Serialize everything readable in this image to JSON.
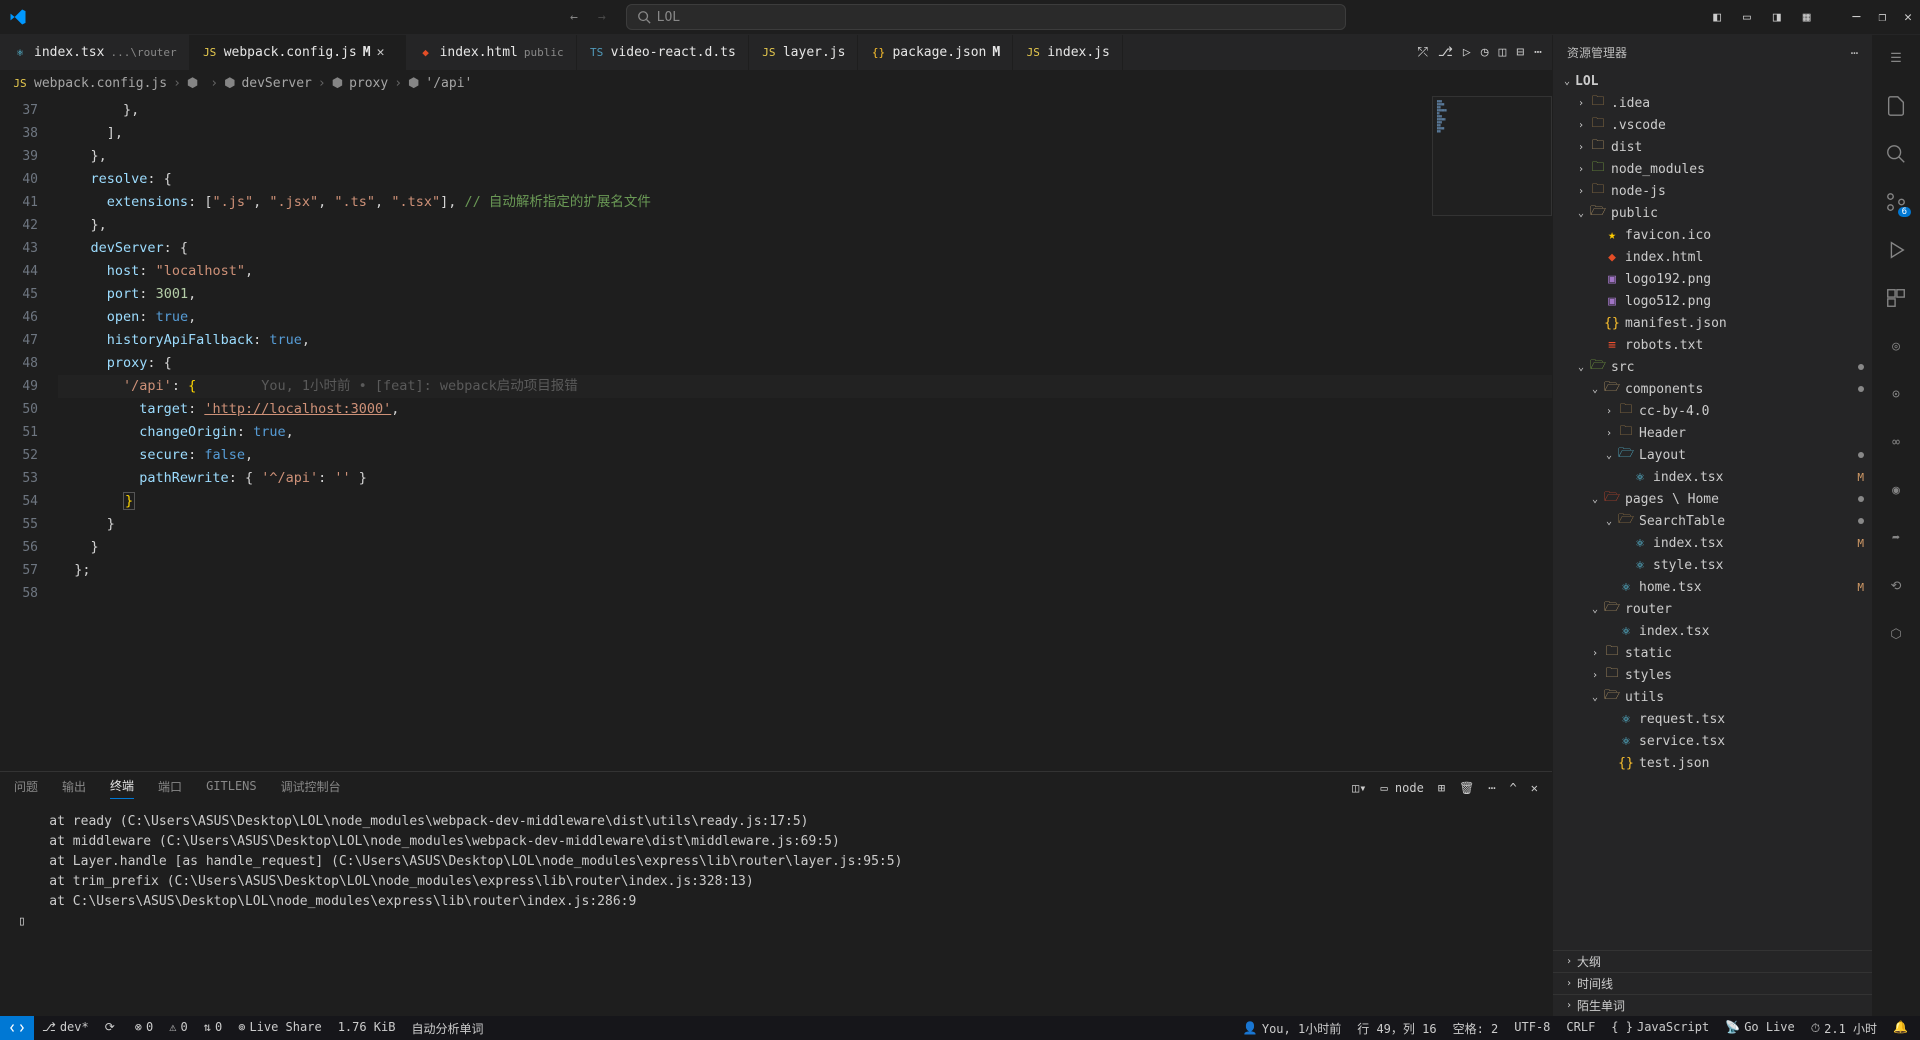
{
  "title": {
    "search": "LOL"
  },
  "tabs": [
    {
      "icon": "react",
      "name": "index.tsx",
      "path": "...\\router",
      "active": false
    },
    {
      "icon": "js",
      "name": "webpack.config.js",
      "mod": "M",
      "active": true,
      "close": true
    },
    {
      "icon": "html",
      "name": "index.html",
      "path": "public",
      "active": false
    },
    {
      "icon": "ts",
      "name": "video-react.d.ts",
      "active": false
    },
    {
      "icon": "js",
      "name": "layer.js",
      "active": false
    },
    {
      "icon": "json",
      "name": "package.json",
      "mod": "M",
      "active": false
    },
    {
      "icon": "js",
      "name": "index.js",
      "active": false
    }
  ],
  "breadcrumb": [
    "webpack.config.js",
    "<unknown>",
    "devServer",
    "proxy",
    "'/api'"
  ],
  "code": {
    "start": 37,
    "lines": [
      {
        "t": "        },"
      },
      {
        "t": "      ],"
      },
      {
        "t": "    },"
      },
      {
        "t": "    resolve: {",
        "seg": [
          {
            "c": "prop",
            "t": "resolve"
          },
          {
            "c": "punct",
            "t": ": {"
          }
        ]
      },
      {
        "t": "      extensions: [\".js\", \".jsx\", \".ts\", \".tsx\"], // 自动解析指定的扩展名文件",
        "seg": [
          {
            "c": "prop",
            "t": "extensions"
          },
          {
            "c": "punct",
            "t": ": ["
          },
          {
            "c": "str",
            "t": "\".js\""
          },
          {
            "c": "punct",
            "t": ", "
          },
          {
            "c": "str",
            "t": "\".jsx\""
          },
          {
            "c": "punct",
            "t": ", "
          },
          {
            "c": "str",
            "t": "\".ts\""
          },
          {
            "c": "punct",
            "t": ", "
          },
          {
            "c": "str",
            "t": "\".tsx\""
          },
          {
            "c": "punct",
            "t": "], "
          },
          {
            "c": "cmt",
            "t": "// 自动解析指定的扩展名文件"
          }
        ]
      },
      {
        "t": "    },"
      },
      {
        "t": "    devServer: {",
        "seg": [
          {
            "c": "prop",
            "t": "devServer"
          },
          {
            "c": "punct",
            "t": ": {"
          }
        ]
      },
      {
        "t": "      host: \"localhost\",",
        "seg": [
          {
            "c": "prop",
            "t": "host"
          },
          {
            "c": "punct",
            "t": ": "
          },
          {
            "c": "str",
            "t": "\"localhost\""
          },
          {
            "c": "punct",
            "t": ","
          }
        ]
      },
      {
        "t": "      port: 3001,",
        "seg": [
          {
            "c": "prop",
            "t": "port"
          },
          {
            "c": "punct",
            "t": ": "
          },
          {
            "c": "num",
            "t": "3001"
          },
          {
            "c": "punct",
            "t": ","
          }
        ]
      },
      {
        "t": "      open: true,",
        "seg": [
          {
            "c": "prop",
            "t": "open"
          },
          {
            "c": "punct",
            "t": ": "
          },
          {
            "c": "bool",
            "t": "true"
          },
          {
            "c": "punct",
            "t": ","
          }
        ]
      },
      {
        "t": "      historyApiFallback: true,",
        "seg": [
          {
            "c": "prop",
            "t": "historyApiFallback"
          },
          {
            "c": "punct",
            "t": ": "
          },
          {
            "c": "bool",
            "t": "true"
          },
          {
            "c": "punct",
            "t": ","
          }
        ]
      },
      {
        "t": "      proxy: {",
        "seg": [
          {
            "c": "prop",
            "t": "proxy"
          },
          {
            "c": "punct",
            "t": ": {"
          }
        ]
      },
      {
        "t": "        '/api': {",
        "cursor": true,
        "seg": [
          {
            "c": "str",
            "t": "'/api'"
          },
          {
            "c": "punct",
            "t": ": "
          },
          {
            "c": "bracket",
            "t": "{"
          }
        ],
        "lens": "        You, 1小时前 • [feat]: webpack启动项目报错"
      },
      {
        "t": "          target: 'http://localhost:3000',",
        "seg": [
          {
            "c": "prop",
            "t": "target"
          },
          {
            "c": "punct",
            "t": ": "
          },
          {
            "c": "link",
            "t": "'http://localhost:3000'"
          },
          {
            "c": "punct",
            "t": ","
          }
        ]
      },
      {
        "t": "          changeOrigin: true,",
        "seg": [
          {
            "c": "prop",
            "t": "changeOrigin"
          },
          {
            "c": "punct",
            "t": ": "
          },
          {
            "c": "bool",
            "t": "true"
          },
          {
            "c": "punct",
            "t": ","
          }
        ]
      },
      {
        "t": "          secure: false,",
        "seg": [
          {
            "c": "prop",
            "t": "secure"
          },
          {
            "c": "punct",
            "t": ": "
          },
          {
            "c": "bool",
            "t": "false"
          },
          {
            "c": "punct",
            "t": ","
          }
        ]
      },
      {
        "t": "          pathRewrite: { '^/api': '' }",
        "seg": [
          {
            "c": "prop",
            "t": "pathRewrite"
          },
          {
            "c": "punct",
            "t": ": { "
          },
          {
            "c": "str",
            "t": "'^/api'"
          },
          {
            "c": "punct",
            "t": ": "
          },
          {
            "c": "str",
            "t": "''"
          },
          {
            "c": "punct",
            "t": " }"
          }
        ]
      },
      {
        "t": "        }",
        "seg": [
          {
            "c": "bracket",
            "t": "}"
          }
        ],
        "box": true
      },
      {
        "t": "      }"
      },
      {
        "t": "    }"
      },
      {
        "t": "  };"
      },
      {
        "t": ""
      }
    ]
  },
  "panel": {
    "tabs": [
      "问题",
      "输出",
      "终端",
      "端口",
      "GITLENS",
      "调试控制台"
    ],
    "active": "终端",
    "term_label": "node",
    "body": "    at ready (C:\\Users\\ASUS\\Desktop\\LOL\\node_modules\\webpack-dev-middleware\\dist\\utils\\ready.js:17:5)\n    at middleware (C:\\Users\\ASUS\\Desktop\\LOL\\node_modules\\webpack-dev-middleware\\dist\\middleware.js:69:5)\n    at Layer.handle [as handle_request] (C:\\Users\\ASUS\\Desktop\\LOL\\node_modules\\express\\lib\\router\\layer.js:95:5)\n    at trim_prefix (C:\\Users\\ASUS\\Desktop\\LOL\\node_modules\\express\\lib\\router\\index.js:328:13)\n    at C:\\Users\\ASUS\\Desktop\\LOL\\node_modules\\express\\lib\\router\\index.js:286:9\n▯"
  },
  "explorer": {
    "title": "资源管理器",
    "root": "LOL",
    "sections": [
      "大纲",
      "时间线",
      "陌生单词"
    ],
    "tree": [
      {
        "d": 1,
        "tw": ">",
        "ico": "folder",
        "name": ".idea"
      },
      {
        "d": 1,
        "tw": ">",
        "ico": "folder",
        "name": ".vscode"
      },
      {
        "d": 1,
        "tw": ">",
        "ico": "folder",
        "col": "ic-folder",
        "name": "dist"
      },
      {
        "d": 1,
        "tw": ">",
        "ico": "folder",
        "col": "ic-green",
        "name": "node_modules"
      },
      {
        "d": 1,
        "tw": ">",
        "ico": "folder",
        "name": "node-js"
      },
      {
        "d": 1,
        "tw": "v",
        "ico": "folder-o",
        "col": "ic-folder",
        "name": "public"
      },
      {
        "d": 2,
        "ico": "star",
        "col": "ic-fav",
        "name": "favicon.ico"
      },
      {
        "d": 2,
        "ico": "html",
        "col": "ic-html",
        "name": "index.html"
      },
      {
        "d": 2,
        "ico": "img",
        "col": "ic-img",
        "name": "logo192.png"
      },
      {
        "d": 2,
        "ico": "img",
        "col": "ic-img",
        "name": "logo512.png"
      },
      {
        "d": 2,
        "ico": "json",
        "col": "ic-json",
        "name": "manifest.json"
      },
      {
        "d": 2,
        "ico": "txt",
        "col": "ic-git",
        "name": "robots.txt"
      },
      {
        "d": 1,
        "tw": "v",
        "ico": "folder-o",
        "col": "ic-green",
        "name": "src",
        "dot": true
      },
      {
        "d": 2,
        "tw": "v",
        "ico": "folder-o",
        "col": "ic-folder",
        "name": "components",
        "dot": true
      },
      {
        "d": 3,
        "tw": ">",
        "ico": "folder",
        "name": "cc-by-4.0"
      },
      {
        "d": 3,
        "tw": ">",
        "ico": "folder",
        "name": "Header"
      },
      {
        "d": 3,
        "tw": "v",
        "ico": "folder-o",
        "col": "ic-react",
        "name": "Layout",
        "dot": true
      },
      {
        "d": 4,
        "ico": "react",
        "col": "ic-react",
        "name": "index.tsx",
        "badge": "M"
      },
      {
        "d": 2,
        "tw": "v",
        "ico": "folder-o",
        "col": "ic-git",
        "name": "pages \\ Home",
        "dot": true
      },
      {
        "d": 3,
        "tw": "v",
        "ico": "folder-o",
        "name": "SearchTable",
        "dot": true
      },
      {
        "d": 4,
        "ico": "react",
        "col": "ic-react",
        "name": "index.tsx",
        "badge": "M"
      },
      {
        "d": 4,
        "ico": "react",
        "col": "ic-react",
        "name": "style.tsx"
      },
      {
        "d": 3,
        "ico": "react",
        "col": "ic-react",
        "name": "home.tsx",
        "badge": "M"
      },
      {
        "d": 2,
        "tw": "v",
        "ico": "folder-o",
        "col": "ic-folder",
        "name": "router"
      },
      {
        "d": 3,
        "ico": "react",
        "col": "ic-react",
        "name": "index.tsx"
      },
      {
        "d": 2,
        "tw": ">",
        "ico": "folder",
        "col": "ic-folder",
        "name": "static"
      },
      {
        "d": 2,
        "tw": ">",
        "ico": "folder",
        "col": "ic-folder",
        "name": "styles"
      },
      {
        "d": 2,
        "tw": "v",
        "ico": "folder-o",
        "col": "ic-folder",
        "name": "utils"
      },
      {
        "d": 3,
        "ico": "react",
        "col": "ic-react",
        "name": "request.tsx"
      },
      {
        "d": 3,
        "ico": "react",
        "col": "ic-react",
        "name": "service.tsx"
      },
      {
        "d": 3,
        "ico": "json",
        "col": "ic-json",
        "name": "test.json"
      }
    ]
  },
  "activity_badge": "6",
  "status": {
    "left": [
      {
        "ico": "branch",
        "t": "dev*"
      },
      {
        "ico": "sync",
        "t": ""
      },
      {
        "ico": "err",
        "t": "0"
      },
      {
        "ico": "warn",
        "t": "0"
      },
      {
        "ico": "port",
        "t": "0"
      },
      {
        "ico": "live",
        "t": "Live Share"
      },
      {
        "t": "1.76 KiB"
      },
      {
        "t": "自动分析单词"
      }
    ],
    "right": [
      {
        "ico": "user",
        "t": "You, 1小时前"
      },
      {
        "t": "行 49，列 16"
      },
      {
        "t": "空格: 2"
      },
      {
        "t": "UTF-8"
      },
      {
        "t": "CRLF"
      },
      {
        "ico": "js",
        "t": "JavaScript"
      },
      {
        "ico": "radio",
        "t": "Go Live"
      },
      {
        "ico": "clock",
        "t": "2.1 小时"
      },
      {
        "ico": "bell",
        "t": ""
      }
    ]
  }
}
